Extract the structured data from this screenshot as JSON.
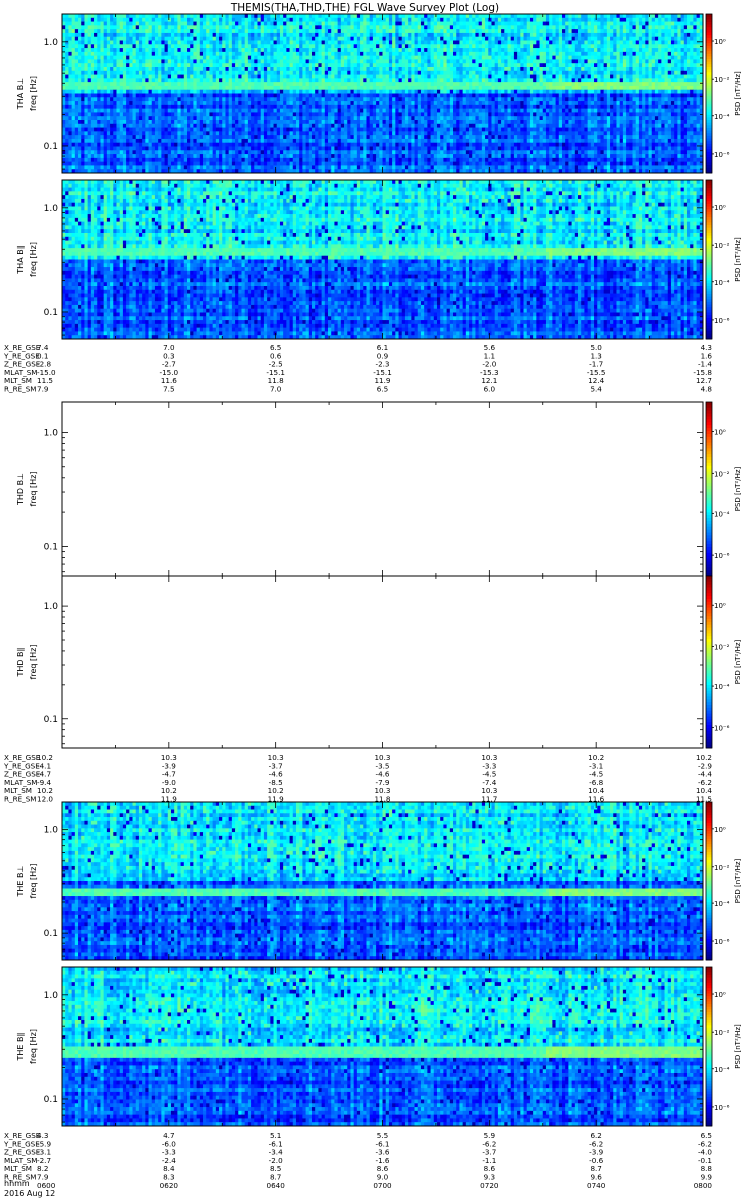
{
  "title": "THEMIS(THA,THD,THE) FGL Wave Survey Plot (Log)",
  "chart_data": {
    "type": "heatmap",
    "title": "THEMIS(THA,THD,THE) FGL Wave Survey Plot (Log)",
    "xlabel": "hhmm",
    "date_label": "2016 Aug 12",
    "x_ticks": [
      "0600",
      "0620",
      "0640",
      "0700",
      "0720",
      "0740",
      "0800"
    ],
    "y_scale": "log",
    "y_ticks": [
      "1.0",
      "0.1"
    ],
    "colorbar": {
      "label": "PSD [nT²/Hz]",
      "scale": "log",
      "ticks": [
        "10⁰",
        "10⁻²",
        "10⁻⁴",
        "10⁻⁶"
      ]
    },
    "panels": [
      {
        "probe": "THA",
        "component": "B⊥",
        "ylabel_top": "THA B⊥",
        "ylabel": "freq [Hz]",
        "has_data": true,
        "bright_band_freq": 0.38
      },
      {
        "probe": "THA",
        "component": "B∥",
        "ylabel_top": "THA B∥",
        "ylabel": "freq [Hz]",
        "has_data": true,
        "bright_band_freq": 0.38
      },
      {
        "probe": "THD",
        "component": "B⊥",
        "ylabel_top": "THD B⊥",
        "ylabel": "freq [Hz]",
        "has_data": false
      },
      {
        "probe": "THD",
        "component": "B∥",
        "ylabel_top": "THD B∥",
        "ylabel": "freq [Hz]",
        "has_data": false
      },
      {
        "probe": "THE",
        "component": "B⊥",
        "ylabel_top": "THE B⊥",
        "ylabel": "freq [Hz]",
        "has_data": true,
        "bright_band_freq": 0.25
      },
      {
        "probe": "THE",
        "component": "B∥",
        "ylabel_top": "THE B∥",
        "ylabel": "freq [Hz]",
        "has_data": true,
        "bright_band_freq": 0.28
      }
    ],
    "ephemeris_blocks": [
      {
        "probe": "THA",
        "rows": [
          {
            "label": "X_RE_GSE",
            "values": [
              "7.4",
              "7.0",
              "6.5",
              "6.1",
              "5.6",
              "5.0",
              "4.3"
            ]
          },
          {
            "label": "Y_RE_GSE",
            "values": [
              "0.1",
              "0.3",
              "0.6",
              "0.9",
              "1.1",
              "1.3",
              "1.6"
            ]
          },
          {
            "label": "Z_RE_GSE",
            "values": [
              "-2.8",
              "-2.7",
              "-2.5",
              "-2.3",
              "-2.0",
              "-1.7",
              "-1.4"
            ]
          },
          {
            "label": "MLAT_SM",
            "values": [
              "-15.0",
              "-15.0",
              "-15.1",
              "-15.1",
              "-15.3",
              "-15.5",
              "-15.8"
            ]
          },
          {
            "label": "MLT_SM",
            "values": [
              "11.5",
              "11.6",
              "11.8",
              "11.9",
              "12.1",
              "12.4",
              "12.7"
            ]
          },
          {
            "label": "R_RE_SM",
            "values": [
              "7.9",
              "7.5",
              "7.0",
              "6.5",
              "6.0",
              "5.4",
              "4.8"
            ]
          }
        ]
      },
      {
        "probe": "THD",
        "rows": [
          {
            "label": "X_RE_GSE",
            "values": [
              "10.2",
              "10.3",
              "10.3",
              "10.3",
              "10.3",
              "10.2",
              "10.2"
            ]
          },
          {
            "label": "Y_RE_GSE",
            "values": [
              "-4.1",
              "-3.9",
              "-3.7",
              "-3.5",
              "-3.3",
              "-3.1",
              "-2.9"
            ]
          },
          {
            "label": "Z_RE_GSE",
            "values": [
              "-4.7",
              "-4.7",
              "-4.6",
              "-4.6",
              "-4.5",
              "-4.5",
              "-4.4"
            ]
          },
          {
            "label": "MLAT_SM",
            "values": [
              "-9.4",
              "-9.0",
              "-8.5",
              "-7.9",
              "-7.4",
              "-6.8",
              "-6.2"
            ]
          },
          {
            "label": "MLT_SM",
            "values": [
              "10.2",
              "10.2",
              "10.2",
              "10.3",
              "10.3",
              "10.4",
              "10.4"
            ]
          },
          {
            "label": "R_RE_SM",
            "values": [
              "12.0",
              "11.9",
              "11.9",
              "11.8",
              "11.7",
              "11.6",
              "11.5"
            ]
          }
        ]
      },
      {
        "probe": "THE",
        "rows": [
          {
            "label": "X_RE_GSE",
            "values": [
              "4.3",
              "4.7",
              "5.1",
              "5.5",
              "5.9",
              "6.2",
              "6.5"
            ]
          },
          {
            "label": "Y_RE_GSE",
            "values": [
              "-5.9",
              "-6.0",
              "-6.1",
              "-6.1",
              "-6.2",
              "-6.2",
              "-6.2"
            ]
          },
          {
            "label": "Z_RE_GSE",
            "values": [
              "-3.1",
              "-3.3",
              "-3.4",
              "-3.6",
              "-3.7",
              "-3.9",
              "-4.0"
            ]
          },
          {
            "label": "MLAT_SM",
            "values": [
              "-2.7",
              "-2.4",
              "-2.0",
              "-1.6",
              "-1.1",
              "-0.6",
              "-0.1"
            ]
          },
          {
            "label": "MLT_SM",
            "values": [
              "8.2",
              "8.4",
              "8.5",
              "8.6",
              "8.6",
              "8.7",
              "8.8"
            ]
          },
          {
            "label": "R_RE_SM",
            "values": [
              "7.9",
              "8.3",
              "8.7",
              "9.0",
              "9.3",
              "9.6",
              "9.9"
            ]
          }
        ]
      }
    ]
  }
}
